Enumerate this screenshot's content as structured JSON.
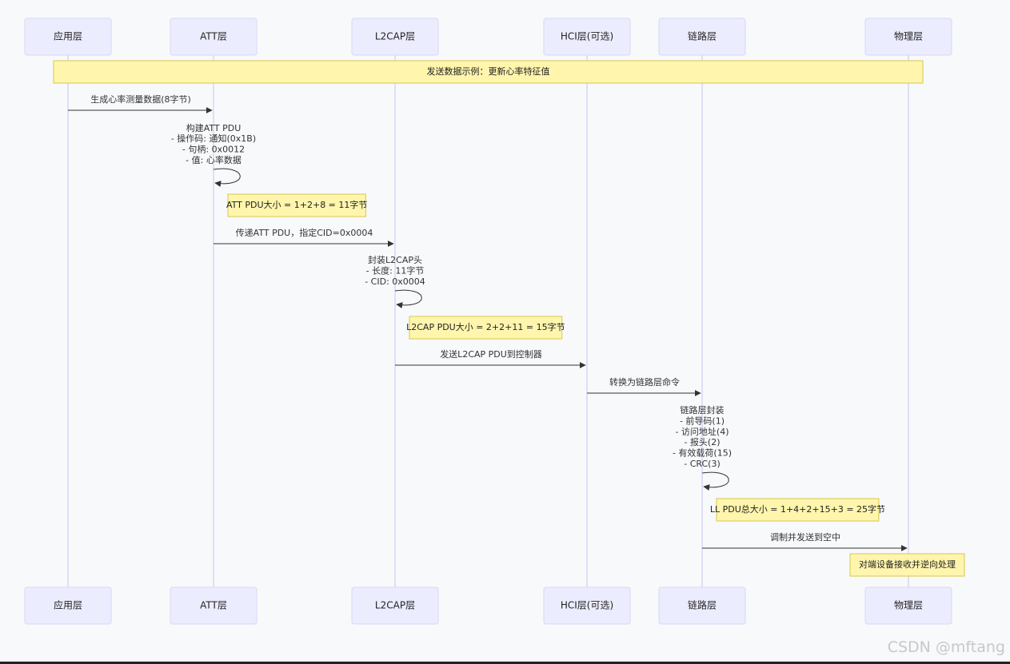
{
  "participants": [
    {
      "id": "app",
      "label": "应用层"
    },
    {
      "id": "att",
      "label": "ATT层"
    },
    {
      "id": "l2cap",
      "label": "L2CAP层"
    },
    {
      "id": "hci",
      "label": "HCI层(可选)"
    },
    {
      "id": "ll",
      "label": "链路层"
    },
    {
      "id": "phy",
      "label": "物理层"
    }
  ],
  "steps": [
    {
      "kind": "note",
      "over": [
        "app",
        "phy"
      ],
      "text": "发送数据示例：更新心率特征值"
    },
    {
      "kind": "message",
      "from": "app",
      "to": "att",
      "lines": [
        "生成心率测量数据(8字节)"
      ]
    },
    {
      "kind": "self",
      "on": "att",
      "lines": [
        "构建ATT PDU",
        "- 操作码: 通知(0x1B)",
        "- 句柄: 0x0012",
        "- 值: 心率数据"
      ]
    },
    {
      "kind": "note",
      "rightOf": "att",
      "text": "ATT PDU大小 = 1+2+8 = 11字节"
    },
    {
      "kind": "message",
      "from": "att",
      "to": "l2cap",
      "lines": [
        "传递ATT PDU，指定CID=0x0004"
      ]
    },
    {
      "kind": "self",
      "on": "l2cap",
      "lines": [
        "封装L2CAP头",
        "- 长度: 11字节",
        "- CID: 0x0004"
      ]
    },
    {
      "kind": "note",
      "rightOf": "l2cap",
      "text": "L2CAP PDU大小 = 2+2+11 = 15字节"
    },
    {
      "kind": "message",
      "from": "l2cap",
      "to": "hci",
      "lines": [
        "发送L2CAP PDU到控制器"
      ]
    },
    {
      "kind": "message",
      "from": "hci",
      "to": "ll",
      "lines": [
        "转换为链路层命令"
      ]
    },
    {
      "kind": "self",
      "on": "ll",
      "lines": [
        "链路层封装",
        "- 前导码(1)",
        "- 访问地址(4)",
        "- 报头(2)",
        "- 有效载荷(15)",
        "- CRC(3)"
      ]
    },
    {
      "kind": "note",
      "rightOf": "ll",
      "text": "LL PDU总大小 = 1+4+2+15+3 = 25字节"
    },
    {
      "kind": "message",
      "from": "ll",
      "to": "phy",
      "lines": [
        "调制并发送到空中"
      ]
    },
    {
      "kind": "note",
      "over": [
        "phy"
      ],
      "text": "对端设备接收并逆向处理"
    }
  ],
  "watermark": "CSDN @mftang",
  "colors": {
    "actor_fill": "#ececff",
    "actor_border": "#d9d6f5",
    "lifeline": "#c9c4f0",
    "note_fill": "#fff5ad",
    "note_border": "#d6c94a",
    "message_line": "#333333"
  }
}
